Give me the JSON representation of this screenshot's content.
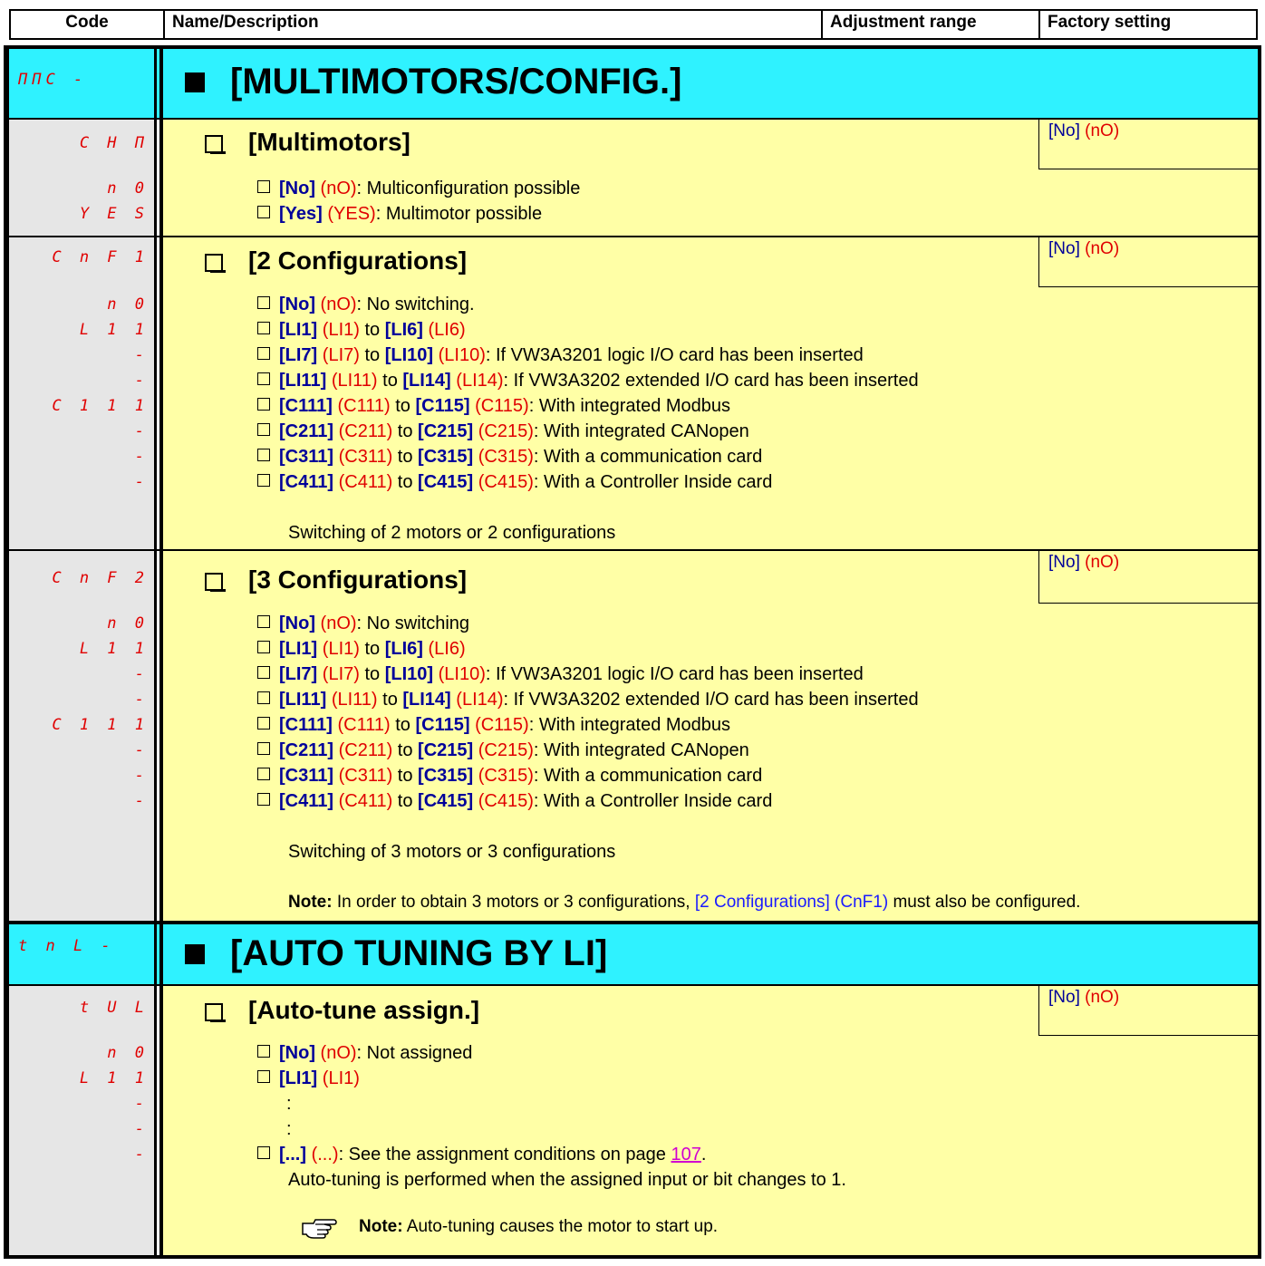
{
  "header": {
    "code": "Code",
    "name": "Name/Description",
    "range": "Adjustment range",
    "factory": "Factory setting"
  },
  "sections": {
    "mmc": {
      "code": "ΠΠC -",
      "title": "[MULTIMOTORS/CONFIG.]"
    },
    "tnl": {
      "code": "t n L -",
      "title": "[AUTO TUNING BY LI]"
    }
  },
  "chm": {
    "code": "C H Π",
    "title": "[Multimotors]",
    "factory_bracket": "[No]",
    "factory_code": "(nO)",
    "codes": [
      "n 0",
      "Y E S"
    ],
    "options": [
      {
        "label": "[No]",
        "code": "(nO)",
        "desc": ": Multiconfiguration possible"
      },
      {
        "label": "[Yes]",
        "code": "(YES)",
        "desc": ": Multimotor possible"
      }
    ]
  },
  "cnf1": {
    "code": "C n F 1",
    "title": "[2 Configurations]",
    "factory_bracket": "[No]",
    "factory_code": "(nO)",
    "codes": [
      "n 0",
      "L 1 1",
      "-",
      "-",
      "C 1 1 1",
      "-",
      "-",
      "-"
    ],
    "options": [
      {
        "l1": "[No]",
        "c1": "(nO)",
        "desc": ": No switching."
      },
      {
        "l1": "[LI1]",
        "c1": "(LI1)",
        "to": " to ",
        "l2": "[LI6]",
        "c2": "(LI6)"
      },
      {
        "l1": "[LI7]",
        "c1": "(LI7)",
        "to": " to ",
        "l2": "[LI10]",
        "c2": "(LI10)",
        "desc": ": If VW3A3201 logic I/O card has been inserted"
      },
      {
        "l1": "[LI11]",
        "c1": "(LI11)",
        "to": " to ",
        "l2": "[LI14]",
        "c2": "(LI14)",
        "desc": ": If VW3A3202 extended I/O card has been inserted"
      },
      {
        "l1": "[C111]",
        "c1": "(C111)",
        "to": " to ",
        "l2": "[C115]",
        "c2": "(C115)",
        "desc": ": With integrated Modbus"
      },
      {
        "l1": "[C211]",
        "c1": "(C211)",
        "to": " to ",
        "l2": "[C215]",
        "c2": "(C215)",
        "desc": ": With integrated CANopen"
      },
      {
        "l1": "[C311]",
        "c1": "(C311)",
        "to": " to ",
        "l2": "[C315]",
        "c2": "(C315)",
        "desc": ": With a communication card"
      },
      {
        "l1": "[C411]",
        "c1": "(C411)",
        "to": " to ",
        "l2": "[C415]",
        "c2": "(C415)",
        "desc": ": With a Controller Inside card"
      }
    ],
    "footer": "Switching of 2 motors or 2 configurations"
  },
  "cnf2": {
    "code": "C n F 2",
    "title": "[3 Configurations]",
    "factory_bracket": "[No]",
    "factory_code": "(nO)",
    "codes": [
      "n 0",
      "L 1 1",
      "-",
      "-",
      "C 1 1 1",
      "-",
      "-",
      "-"
    ],
    "options": [
      {
        "l1": "[No]",
        "c1": "(nO)",
        "desc": ": No switching"
      },
      {
        "l1": "[LI1]",
        "c1": "(LI1)",
        "to": " to ",
        "l2": "[LI6]",
        "c2": "(LI6)"
      },
      {
        "l1": "[LI7]",
        "c1": "(LI7)",
        "to": " to ",
        "l2": "[LI10]",
        "c2": "(LI10)",
        "desc": ": If VW3A3201 logic I/O card has been inserted"
      },
      {
        "l1": "[LI11]",
        "c1": "(LI11)",
        "to": " to ",
        "l2": "[LI14]",
        "c2": "(LI14)",
        "desc": ": If VW3A3202 extended I/O card has been inserted"
      },
      {
        "l1": "[C111]",
        "c1": "(C111)",
        "to": " to ",
        "l2": "[C115]",
        "c2": "(C115)",
        "desc": ": With integrated Modbus"
      },
      {
        "l1": "[C211]",
        "c1": "(C211)",
        "to": " to ",
        "l2": "[C215]",
        "c2": "(C215)",
        "desc": ": With integrated CANopen"
      },
      {
        "l1": "[C311]",
        "c1": "(C311)",
        "to": " to ",
        "l2": "[C315]",
        "c2": "(C315)",
        "desc": ": With a communication card"
      },
      {
        "l1": "[C411]",
        "c1": "(C411)",
        "to": " to ",
        "l2": "[C415]",
        "c2": "(C415)",
        "desc": ": With a Controller Inside card"
      }
    ],
    "footer": "Switching of 3 motors or 3 configurations",
    "note_label": "Note:",
    "note_text": " In order to obtain 3 motors or 3 configurations, ",
    "note_link": "[2 Configurations] (CnF1)",
    "note_tail": " must also be configured."
  },
  "tul": {
    "code": "t U L",
    "title": "[Auto-tune assign.]",
    "factory_bracket": "[No]",
    "factory_code": "(nO)",
    "codes": [
      "n 0",
      "L 1 1",
      "-",
      "-",
      "-"
    ],
    "opt_no": {
      "label": "[No]",
      "code": "(nO)",
      "desc": ": Not assigned"
    },
    "opt_li1": {
      "label": "[LI1]",
      "code": "(LI1)"
    },
    "dots": [
      ":",
      ":"
    ],
    "opt_more": {
      "label": "[...]",
      "code": "(...)",
      "desc": ": See the assignment conditions on page ",
      "page": "107",
      "end": "."
    },
    "desc2": "Auto-tuning is performed when the assigned input or bit changes to 1.",
    "note_label": "Note:",
    "note_text": " Auto-tuning causes the motor to start up."
  }
}
